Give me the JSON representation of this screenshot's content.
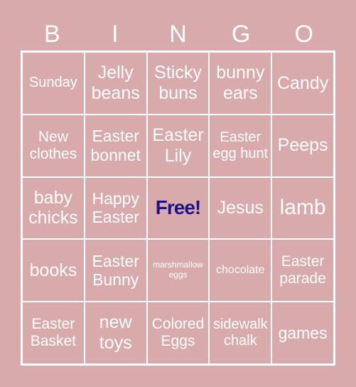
{
  "header": {
    "letters": [
      "B",
      "I",
      "N",
      "G",
      "O"
    ]
  },
  "colors": {
    "background": "#d9aaab",
    "text": "#ffffff",
    "grid_lines": "#ffffff",
    "free_text": "#1c1489"
  },
  "cells": [
    [
      "Sunday",
      "Jelly beans",
      "Sticky buns",
      "bunny ears",
      "Candy"
    ],
    [
      "New clothes",
      "Easter bonnet",
      "Easter Lily",
      "Easter egg hunt",
      "Peeps"
    ],
    [
      "baby chicks",
      "Happy Easter",
      "Free!",
      "Jesus",
      "lamb"
    ],
    [
      "books",
      "Easter Bunny",
      "marshmallow eggs",
      "chocolate",
      "Easter parade"
    ],
    [
      "Easter Basket",
      "new toys",
      "Colored Eggs",
      "sidewalk chalk",
      "games"
    ]
  ]
}
